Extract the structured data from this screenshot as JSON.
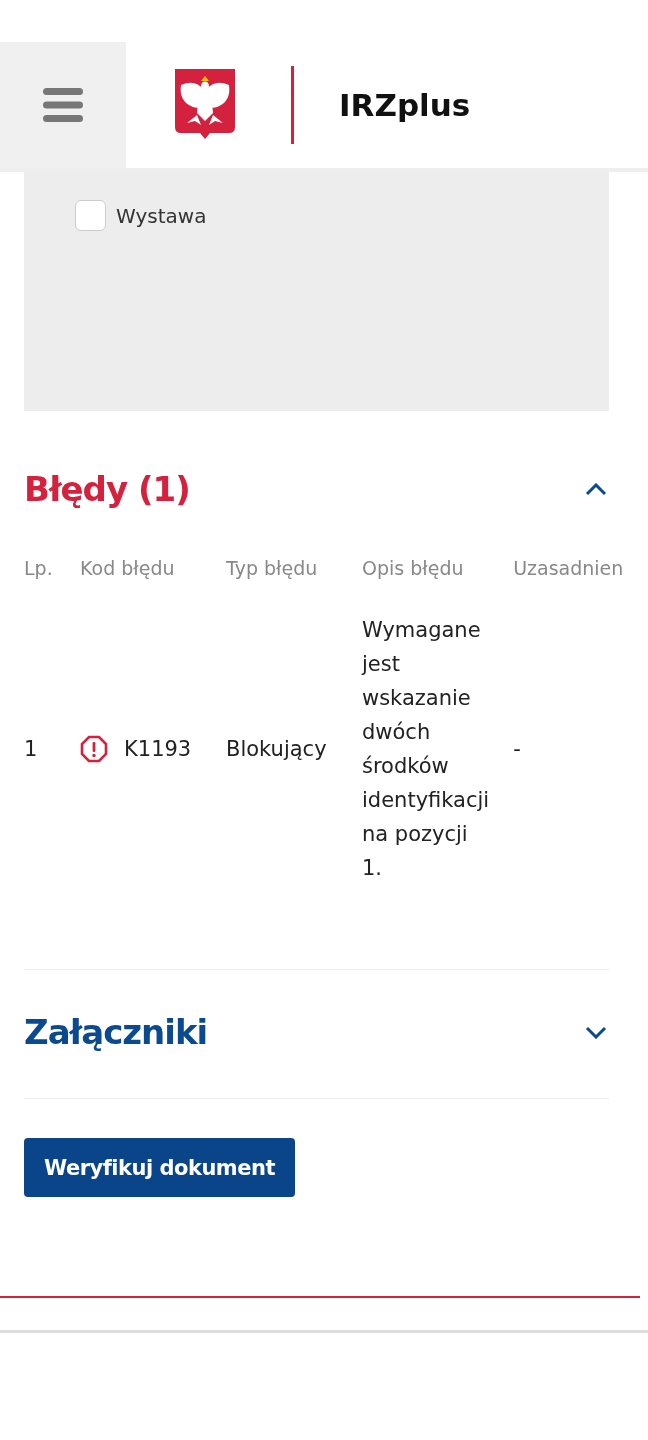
{
  "header": {
    "title": "IRZplus"
  },
  "filters": [
    {
      "label": "Wystawa",
      "checked": false
    }
  ],
  "sections": [
    {
      "title": "Błędy (1)",
      "kind": "error",
      "expanded": true,
      "table": {
        "columns": [
          "Lp.",
          "Kod błędu",
          "Typ błędu",
          "Opis błędu",
          "Uzasadnien"
        ],
        "rows": [
          {
            "cells": [
              "1",
              "K1193",
              "Blokujący",
              "Wymagane jest wskazanie dwóch środków identyfikacji na pozycji 1.",
              "-"
            ]
          }
        ]
      }
    },
    {
      "title": "Załączniki",
      "kind": "normal",
      "expanded": false
    }
  ],
  "actions": [
    {
      "label": "Weryfikuj dokument"
    }
  ]
}
